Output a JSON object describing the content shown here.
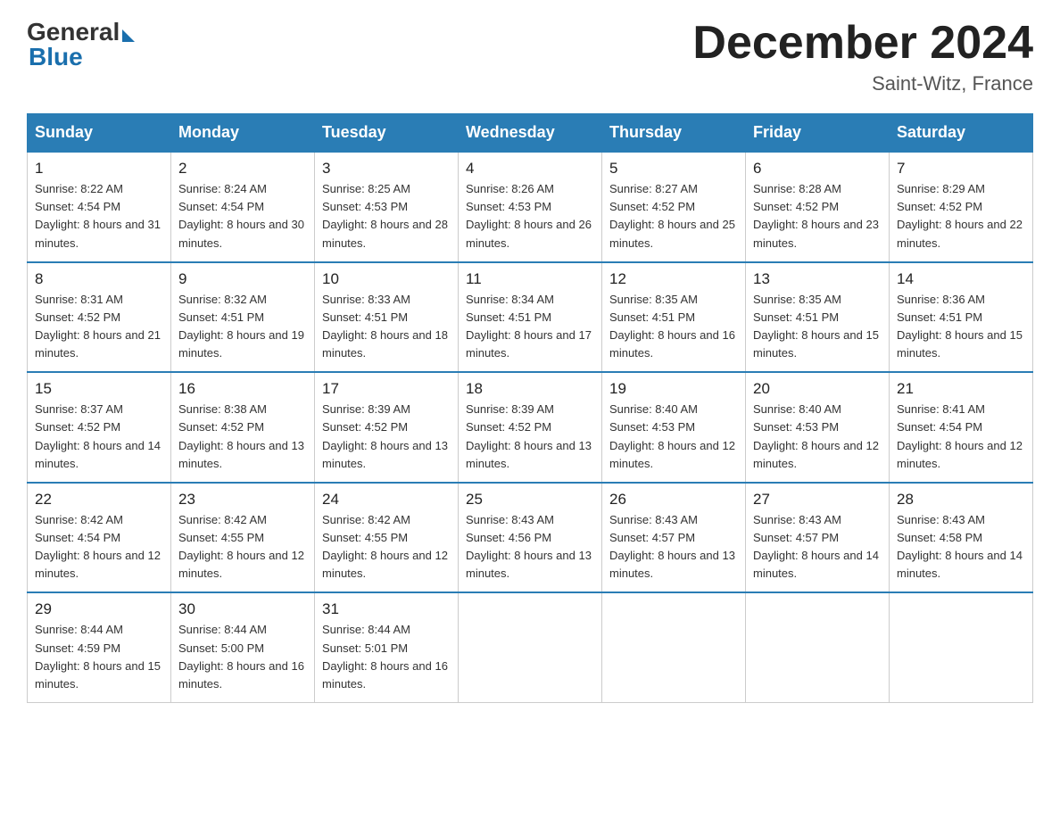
{
  "header": {
    "logo_general": "General",
    "logo_blue": "Blue",
    "month_title": "December 2024",
    "location": "Saint-Witz, France"
  },
  "weekdays": [
    "Sunday",
    "Monday",
    "Tuesday",
    "Wednesday",
    "Thursday",
    "Friday",
    "Saturday"
  ],
  "weeks": [
    [
      {
        "day": "1",
        "sunrise": "Sunrise: 8:22 AM",
        "sunset": "Sunset: 4:54 PM",
        "daylight": "Daylight: 8 hours and 31 minutes."
      },
      {
        "day": "2",
        "sunrise": "Sunrise: 8:24 AM",
        "sunset": "Sunset: 4:54 PM",
        "daylight": "Daylight: 8 hours and 30 minutes."
      },
      {
        "day": "3",
        "sunrise": "Sunrise: 8:25 AM",
        "sunset": "Sunset: 4:53 PM",
        "daylight": "Daylight: 8 hours and 28 minutes."
      },
      {
        "day": "4",
        "sunrise": "Sunrise: 8:26 AM",
        "sunset": "Sunset: 4:53 PM",
        "daylight": "Daylight: 8 hours and 26 minutes."
      },
      {
        "day": "5",
        "sunrise": "Sunrise: 8:27 AM",
        "sunset": "Sunset: 4:52 PM",
        "daylight": "Daylight: 8 hours and 25 minutes."
      },
      {
        "day": "6",
        "sunrise": "Sunrise: 8:28 AM",
        "sunset": "Sunset: 4:52 PM",
        "daylight": "Daylight: 8 hours and 23 minutes."
      },
      {
        "day": "7",
        "sunrise": "Sunrise: 8:29 AM",
        "sunset": "Sunset: 4:52 PM",
        "daylight": "Daylight: 8 hours and 22 minutes."
      }
    ],
    [
      {
        "day": "8",
        "sunrise": "Sunrise: 8:31 AM",
        "sunset": "Sunset: 4:52 PM",
        "daylight": "Daylight: 8 hours and 21 minutes."
      },
      {
        "day": "9",
        "sunrise": "Sunrise: 8:32 AM",
        "sunset": "Sunset: 4:51 PM",
        "daylight": "Daylight: 8 hours and 19 minutes."
      },
      {
        "day": "10",
        "sunrise": "Sunrise: 8:33 AM",
        "sunset": "Sunset: 4:51 PM",
        "daylight": "Daylight: 8 hours and 18 minutes."
      },
      {
        "day": "11",
        "sunrise": "Sunrise: 8:34 AM",
        "sunset": "Sunset: 4:51 PM",
        "daylight": "Daylight: 8 hours and 17 minutes."
      },
      {
        "day": "12",
        "sunrise": "Sunrise: 8:35 AM",
        "sunset": "Sunset: 4:51 PM",
        "daylight": "Daylight: 8 hours and 16 minutes."
      },
      {
        "day": "13",
        "sunrise": "Sunrise: 8:35 AM",
        "sunset": "Sunset: 4:51 PM",
        "daylight": "Daylight: 8 hours and 15 minutes."
      },
      {
        "day": "14",
        "sunrise": "Sunrise: 8:36 AM",
        "sunset": "Sunset: 4:51 PM",
        "daylight": "Daylight: 8 hours and 15 minutes."
      }
    ],
    [
      {
        "day": "15",
        "sunrise": "Sunrise: 8:37 AM",
        "sunset": "Sunset: 4:52 PM",
        "daylight": "Daylight: 8 hours and 14 minutes."
      },
      {
        "day": "16",
        "sunrise": "Sunrise: 8:38 AM",
        "sunset": "Sunset: 4:52 PM",
        "daylight": "Daylight: 8 hours and 13 minutes."
      },
      {
        "day": "17",
        "sunrise": "Sunrise: 8:39 AM",
        "sunset": "Sunset: 4:52 PM",
        "daylight": "Daylight: 8 hours and 13 minutes."
      },
      {
        "day": "18",
        "sunrise": "Sunrise: 8:39 AM",
        "sunset": "Sunset: 4:52 PM",
        "daylight": "Daylight: 8 hours and 13 minutes."
      },
      {
        "day": "19",
        "sunrise": "Sunrise: 8:40 AM",
        "sunset": "Sunset: 4:53 PM",
        "daylight": "Daylight: 8 hours and 12 minutes."
      },
      {
        "day": "20",
        "sunrise": "Sunrise: 8:40 AM",
        "sunset": "Sunset: 4:53 PM",
        "daylight": "Daylight: 8 hours and 12 minutes."
      },
      {
        "day": "21",
        "sunrise": "Sunrise: 8:41 AM",
        "sunset": "Sunset: 4:54 PM",
        "daylight": "Daylight: 8 hours and 12 minutes."
      }
    ],
    [
      {
        "day": "22",
        "sunrise": "Sunrise: 8:42 AM",
        "sunset": "Sunset: 4:54 PM",
        "daylight": "Daylight: 8 hours and 12 minutes."
      },
      {
        "day": "23",
        "sunrise": "Sunrise: 8:42 AM",
        "sunset": "Sunset: 4:55 PM",
        "daylight": "Daylight: 8 hours and 12 minutes."
      },
      {
        "day": "24",
        "sunrise": "Sunrise: 8:42 AM",
        "sunset": "Sunset: 4:55 PM",
        "daylight": "Daylight: 8 hours and 12 minutes."
      },
      {
        "day": "25",
        "sunrise": "Sunrise: 8:43 AM",
        "sunset": "Sunset: 4:56 PM",
        "daylight": "Daylight: 8 hours and 13 minutes."
      },
      {
        "day": "26",
        "sunrise": "Sunrise: 8:43 AM",
        "sunset": "Sunset: 4:57 PM",
        "daylight": "Daylight: 8 hours and 13 minutes."
      },
      {
        "day": "27",
        "sunrise": "Sunrise: 8:43 AM",
        "sunset": "Sunset: 4:57 PM",
        "daylight": "Daylight: 8 hours and 14 minutes."
      },
      {
        "day": "28",
        "sunrise": "Sunrise: 8:43 AM",
        "sunset": "Sunset: 4:58 PM",
        "daylight": "Daylight: 8 hours and 14 minutes."
      }
    ],
    [
      {
        "day": "29",
        "sunrise": "Sunrise: 8:44 AM",
        "sunset": "Sunset: 4:59 PM",
        "daylight": "Daylight: 8 hours and 15 minutes."
      },
      {
        "day": "30",
        "sunrise": "Sunrise: 8:44 AM",
        "sunset": "Sunset: 5:00 PM",
        "daylight": "Daylight: 8 hours and 16 minutes."
      },
      {
        "day": "31",
        "sunrise": "Sunrise: 8:44 AM",
        "sunset": "Sunset: 5:01 PM",
        "daylight": "Daylight: 8 hours and 16 minutes."
      },
      null,
      null,
      null,
      null
    ]
  ]
}
